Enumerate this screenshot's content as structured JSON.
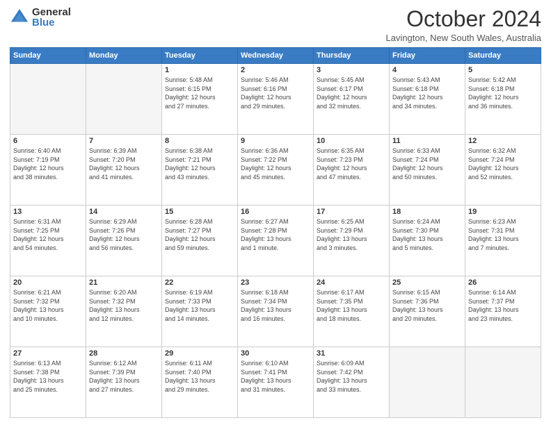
{
  "logo": {
    "general": "General",
    "blue": "Blue"
  },
  "title": "October 2024",
  "location": "Lavington, New South Wales, Australia",
  "days": [
    "Sunday",
    "Monday",
    "Tuesday",
    "Wednesday",
    "Thursday",
    "Friday",
    "Saturday"
  ],
  "weeks": [
    [
      {
        "day": "",
        "info": ""
      },
      {
        "day": "",
        "info": ""
      },
      {
        "day": "1",
        "info": "Sunrise: 5:48 AM\nSunset: 6:15 PM\nDaylight: 12 hours\nand 27 minutes."
      },
      {
        "day": "2",
        "info": "Sunrise: 5:46 AM\nSunset: 6:16 PM\nDaylight: 12 hours\nand 29 minutes."
      },
      {
        "day": "3",
        "info": "Sunrise: 5:45 AM\nSunset: 6:17 PM\nDaylight: 12 hours\nand 32 minutes."
      },
      {
        "day": "4",
        "info": "Sunrise: 5:43 AM\nSunset: 6:18 PM\nDaylight: 12 hours\nand 34 minutes."
      },
      {
        "day": "5",
        "info": "Sunrise: 5:42 AM\nSunset: 6:18 PM\nDaylight: 12 hours\nand 36 minutes."
      }
    ],
    [
      {
        "day": "6",
        "info": "Sunrise: 6:40 AM\nSunset: 7:19 PM\nDaylight: 12 hours\nand 38 minutes."
      },
      {
        "day": "7",
        "info": "Sunrise: 6:39 AM\nSunset: 7:20 PM\nDaylight: 12 hours\nand 41 minutes."
      },
      {
        "day": "8",
        "info": "Sunrise: 6:38 AM\nSunset: 7:21 PM\nDaylight: 12 hours\nand 43 minutes."
      },
      {
        "day": "9",
        "info": "Sunrise: 6:36 AM\nSunset: 7:22 PM\nDaylight: 12 hours\nand 45 minutes."
      },
      {
        "day": "10",
        "info": "Sunrise: 6:35 AM\nSunset: 7:23 PM\nDaylight: 12 hours\nand 47 minutes."
      },
      {
        "day": "11",
        "info": "Sunrise: 6:33 AM\nSunset: 7:24 PM\nDaylight: 12 hours\nand 50 minutes."
      },
      {
        "day": "12",
        "info": "Sunrise: 6:32 AM\nSunset: 7:24 PM\nDaylight: 12 hours\nand 52 minutes."
      }
    ],
    [
      {
        "day": "13",
        "info": "Sunrise: 6:31 AM\nSunset: 7:25 PM\nDaylight: 12 hours\nand 54 minutes."
      },
      {
        "day": "14",
        "info": "Sunrise: 6:29 AM\nSunset: 7:26 PM\nDaylight: 12 hours\nand 56 minutes."
      },
      {
        "day": "15",
        "info": "Sunrise: 6:28 AM\nSunset: 7:27 PM\nDaylight: 12 hours\nand 59 minutes."
      },
      {
        "day": "16",
        "info": "Sunrise: 6:27 AM\nSunset: 7:28 PM\nDaylight: 13 hours\nand 1 minute."
      },
      {
        "day": "17",
        "info": "Sunrise: 6:25 AM\nSunset: 7:29 PM\nDaylight: 13 hours\nand 3 minutes."
      },
      {
        "day": "18",
        "info": "Sunrise: 6:24 AM\nSunset: 7:30 PM\nDaylight: 13 hours\nand 5 minutes."
      },
      {
        "day": "19",
        "info": "Sunrise: 6:23 AM\nSunset: 7:31 PM\nDaylight: 13 hours\nand 7 minutes."
      }
    ],
    [
      {
        "day": "20",
        "info": "Sunrise: 6:21 AM\nSunset: 7:32 PM\nDaylight: 13 hours\nand 10 minutes."
      },
      {
        "day": "21",
        "info": "Sunrise: 6:20 AM\nSunset: 7:32 PM\nDaylight: 13 hours\nand 12 minutes."
      },
      {
        "day": "22",
        "info": "Sunrise: 6:19 AM\nSunset: 7:33 PM\nDaylight: 13 hours\nand 14 minutes."
      },
      {
        "day": "23",
        "info": "Sunrise: 6:18 AM\nSunset: 7:34 PM\nDaylight: 13 hours\nand 16 minutes."
      },
      {
        "day": "24",
        "info": "Sunrise: 6:17 AM\nSunset: 7:35 PM\nDaylight: 13 hours\nand 18 minutes."
      },
      {
        "day": "25",
        "info": "Sunrise: 6:15 AM\nSunset: 7:36 PM\nDaylight: 13 hours\nand 20 minutes."
      },
      {
        "day": "26",
        "info": "Sunrise: 6:14 AM\nSunset: 7:37 PM\nDaylight: 13 hours\nand 23 minutes."
      }
    ],
    [
      {
        "day": "27",
        "info": "Sunrise: 6:13 AM\nSunset: 7:38 PM\nDaylight: 13 hours\nand 25 minutes."
      },
      {
        "day": "28",
        "info": "Sunrise: 6:12 AM\nSunset: 7:39 PM\nDaylight: 13 hours\nand 27 minutes."
      },
      {
        "day": "29",
        "info": "Sunrise: 6:11 AM\nSunset: 7:40 PM\nDaylight: 13 hours\nand 29 minutes."
      },
      {
        "day": "30",
        "info": "Sunrise: 6:10 AM\nSunset: 7:41 PM\nDaylight: 13 hours\nand 31 minutes."
      },
      {
        "day": "31",
        "info": "Sunrise: 6:09 AM\nSunset: 7:42 PM\nDaylight: 13 hours\nand 33 minutes."
      },
      {
        "day": "",
        "info": ""
      },
      {
        "day": "",
        "info": ""
      }
    ]
  ]
}
